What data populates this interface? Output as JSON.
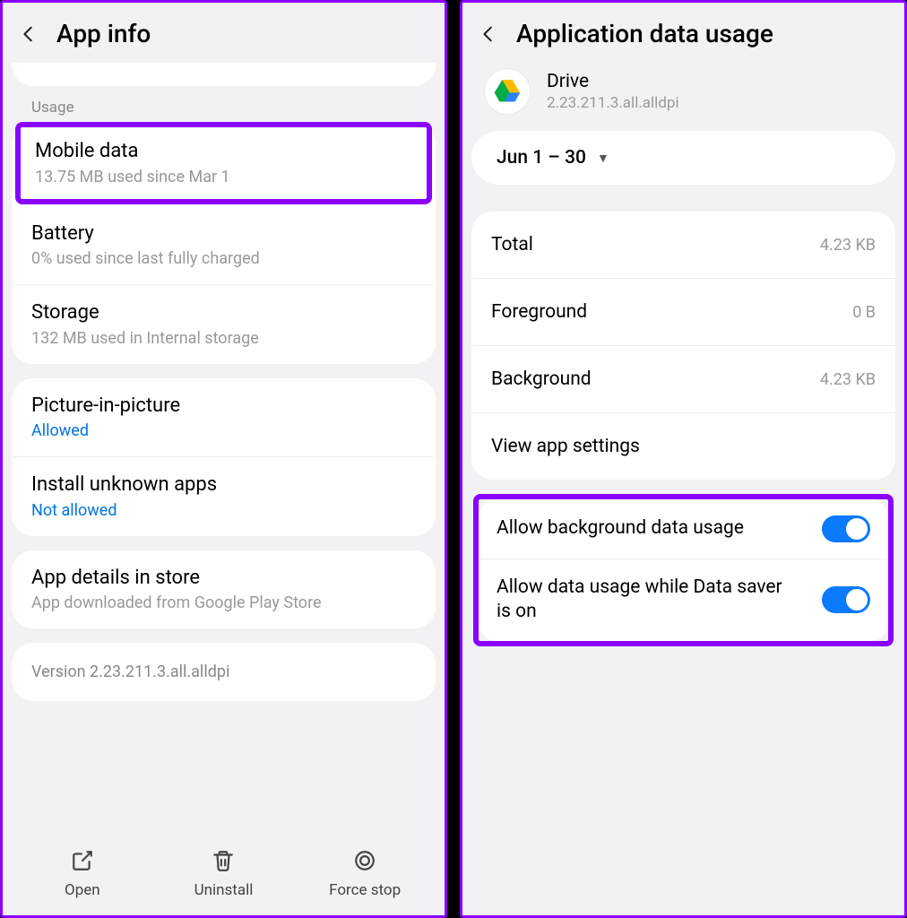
{
  "left": {
    "header": "App info",
    "usage_label": "Usage",
    "mobile_data": {
      "title": "Mobile data",
      "sub": "13.75 MB used since Mar 1"
    },
    "battery": {
      "title": "Battery",
      "sub": "0% used since last fully charged"
    },
    "storage": {
      "title": "Storage",
      "sub": "132 MB used in Internal storage"
    },
    "pip": {
      "title": "Picture-in-picture",
      "sub": "Allowed"
    },
    "unknown": {
      "title": "Install unknown apps",
      "sub": "Not allowed"
    },
    "details": {
      "title": "App details in store",
      "sub": "App downloaded from Google Play Store"
    },
    "version": "Version 2.23.211.3.all.alldpi",
    "actions": {
      "open": "Open",
      "uninstall": "Uninstall",
      "forcestop": "Force stop"
    }
  },
  "right": {
    "header": "Application data usage",
    "app": {
      "name": "Drive",
      "version": "2.23.211.3.all.alldpi"
    },
    "date_range": "Jun 1 – 30",
    "stats": {
      "total": {
        "label": "Total",
        "value": "4.23 KB"
      },
      "foreground": {
        "label": "Foreground",
        "value": "0 B"
      },
      "background": {
        "label": "Background",
        "value": "4.23 KB"
      }
    },
    "view_settings": "View app settings",
    "toggles": {
      "bg": "Allow background data usage",
      "saver": "Allow data usage while Data saver is on"
    }
  }
}
